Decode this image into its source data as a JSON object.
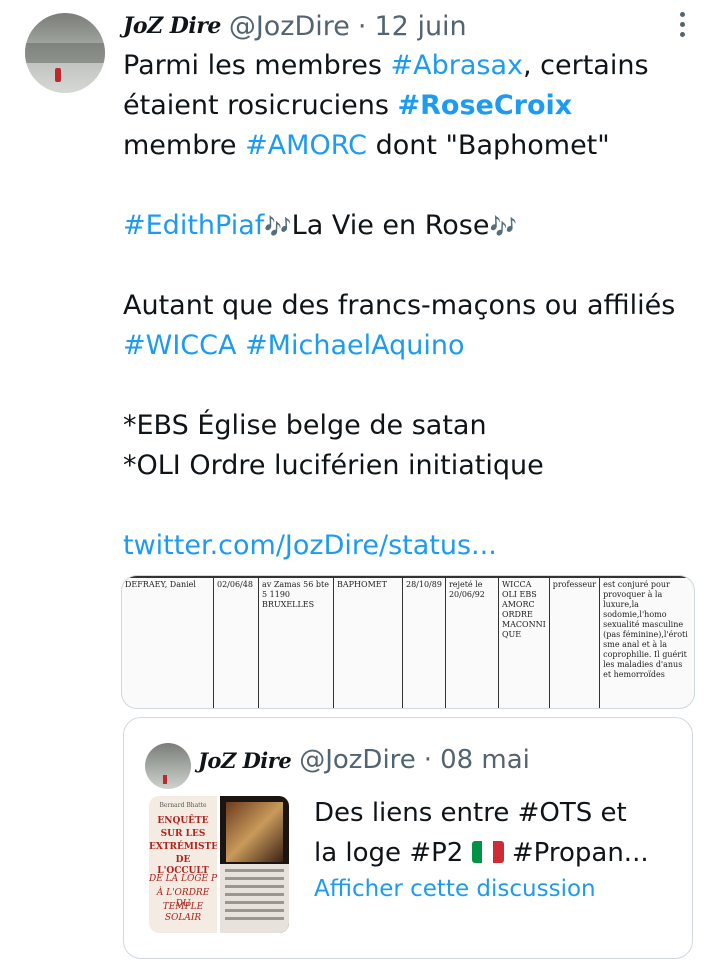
{
  "tweet": {
    "display_name": "JoZ Dire",
    "handle": "@JozDire",
    "separator": "·",
    "date": "12 juin",
    "lines": {
      "l1_a": "Parmi les membres ",
      "l1_tag": "#Abrasax",
      "l1_b": ", certains",
      "l2_a": "étaient rosicruciens ",
      "l2_tag": "#RoseCroix",
      "l3_a": "membre ",
      "l3_tag": "#AMORC",
      "l3_b": " dont \"Baphomet\"",
      "l4_tag": "#EdithPiaf",
      "l4_note1": "🎶",
      "l4_b": "La Vie en Rose",
      "l4_note2": "🎶",
      "l5": "Autant que des francs-maçons ou affiliés",
      "l6_tag1": "#WICCA",
      "l6_tag2": "#MichaelAquino",
      "l7": "*EBS Église belge de satan",
      "l8": "*OLI Ordre luciférien initiatique",
      "link": "twitter.com/JozDire/status..."
    }
  },
  "document": {
    "cells": [
      "DEFRAEY, Daniel",
      "02/06/48",
      "av Zamas 56 bte 5 1190 BRUXELLES",
      "BAPHOMET",
      "28/10/89",
      "rejeté le 20/06/92",
      "WICCA OLI EBS AMORC ORDRE MACONNI QUE",
      "professeur",
      "est conjuré pour provoquer à la luxure,la sodomie,l'homo sexualité masculine (pas féminine),l'éroti sme anal et à la coprophilie. Il guérit les maladies d'anus et hemorroïdes"
    ]
  },
  "quoted": {
    "display_name": "JoZ Dire",
    "handle": "@JozDire",
    "separator": "·",
    "date": "08 mai",
    "line1": "Des liens entre #OTS et",
    "line2_a": "la loge #P2 ",
    "line2_b": " #Propan...",
    "show_thread": "Afficher cette discussion",
    "thumb_author": "Bernard Bhatte",
    "thumb_lines": [
      "ENQUÊTE",
      "SUR LES",
      "EXTRÉMISTE",
      "DE L'OCCULT",
      "DE LA LOGE P",
      "À L'ORDRE DU",
      "TEMPLE SOLAIR"
    ]
  },
  "colors": {
    "accent": "#1d9bf0",
    "secondary": "#536471",
    "text": "#0f1419",
    "border": "#cfd9de",
    "flag": [
      "#009246",
      "#ffffff",
      "#ce2b37"
    ]
  },
  "icons": [
    "more-options-icon",
    "music-notes-icon",
    "italy-flag-icon"
  ]
}
